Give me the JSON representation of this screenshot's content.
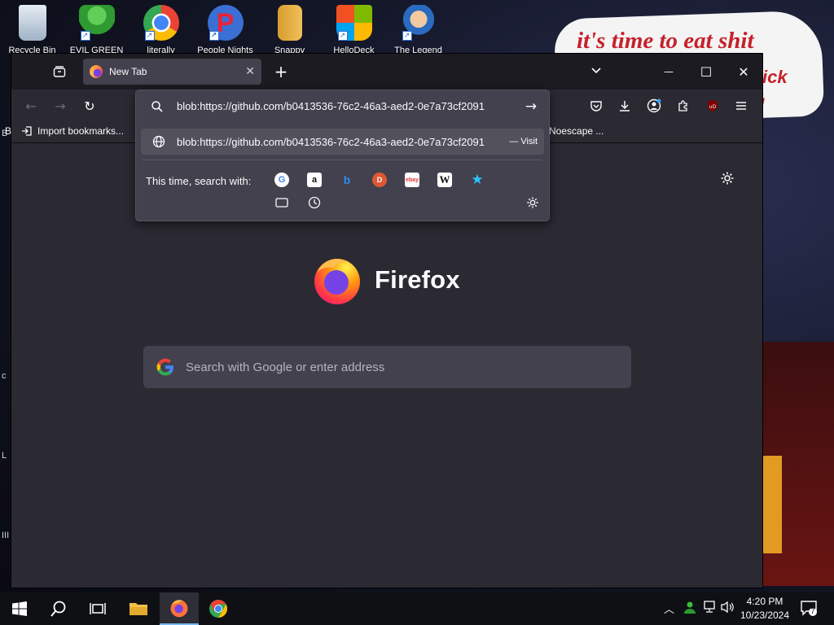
{
  "desktop": {
    "icons": [
      {
        "label": "Recycle Bin",
        "color": "#c9d6e3"
      },
      {
        "label": "EVIL GREEN",
        "color": "#3aa93c"
      },
      {
        "label": "literally",
        "color": "#e8453c"
      },
      {
        "label": "People Nights",
        "color": "#3b6fd4"
      },
      {
        "label": "Snappy",
        "color": "#d89c2e"
      },
      {
        "label": "HelloDeck",
        "color": "#2a9d55"
      },
      {
        "label": "The Legend",
        "color": "#3a78c8"
      }
    ],
    "wallpaper": {
      "line1": "it's time to eat shit",
      "line2": "ick",
      "line3": "!"
    },
    "side_letters": [
      "B",
      "c",
      "L",
      "III"
    ]
  },
  "browser": {
    "tab": {
      "title": "New Tab"
    },
    "window_controls": {
      "minimize": "—",
      "maximize": "☐",
      "close": "✕"
    },
    "bookmarks": {
      "import": "Import bookmarks...",
      "first_letter": "B",
      "other": "Noescape ..."
    },
    "urlbar": {
      "value": "blob:https://github.com/b0413536-76c2-46a3-aed2-0e7a73cf2091",
      "result_text": "blob:https://github.com/b0413536-76c2-46a3-aed2-0e7a73cf2091",
      "result_action": "— Visit",
      "search_with_label": "This time, search with:",
      "engines": [
        "Google",
        "Amazon",
        "Bing",
        "DuckDuckGo",
        "eBay",
        "Wikipedia",
        "Bookmarks",
        "Tabs",
        "History"
      ]
    },
    "newtab": {
      "brand": "Firefox",
      "search_placeholder": "Search with Google or enter address"
    }
  },
  "taskbar": {
    "clock_time": "4:20 PM",
    "clock_date": "10/23/2024",
    "notification_count": "7"
  }
}
